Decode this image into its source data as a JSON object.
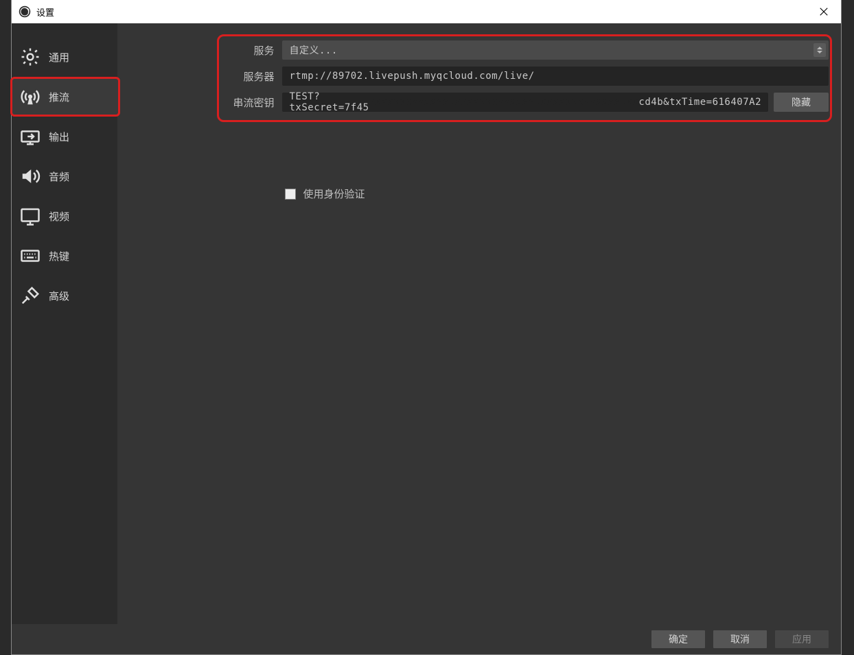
{
  "titlebar": {
    "title": "设置"
  },
  "sidebar": {
    "items": [
      {
        "id": "general",
        "label": "通用"
      },
      {
        "id": "stream",
        "label": "推流"
      },
      {
        "id": "output",
        "label": "输出"
      },
      {
        "id": "audio",
        "label": "音频"
      },
      {
        "id": "video",
        "label": "视频"
      },
      {
        "id": "hotkeys",
        "label": "热键"
      },
      {
        "id": "advanced",
        "label": "高级"
      }
    ],
    "selected": "stream"
  },
  "form": {
    "service_label": "服务",
    "service_value": "自定义...",
    "server_label": "服务器",
    "server_value": "rtmp://89702.livepush.myqcloud.com/live/",
    "streamkey_label": "串流密钥",
    "streamkey_value_prefix": "TEST?txSecret=7f45",
    "streamkey_value_suffix": "cd4b&txTime=616407A2",
    "hide_button_label": "隐藏",
    "auth_checkbox_label": "使用身份验证",
    "auth_checked": false
  },
  "footer": {
    "ok_label": "确定",
    "cancel_label": "取消",
    "apply_label": "应用"
  }
}
